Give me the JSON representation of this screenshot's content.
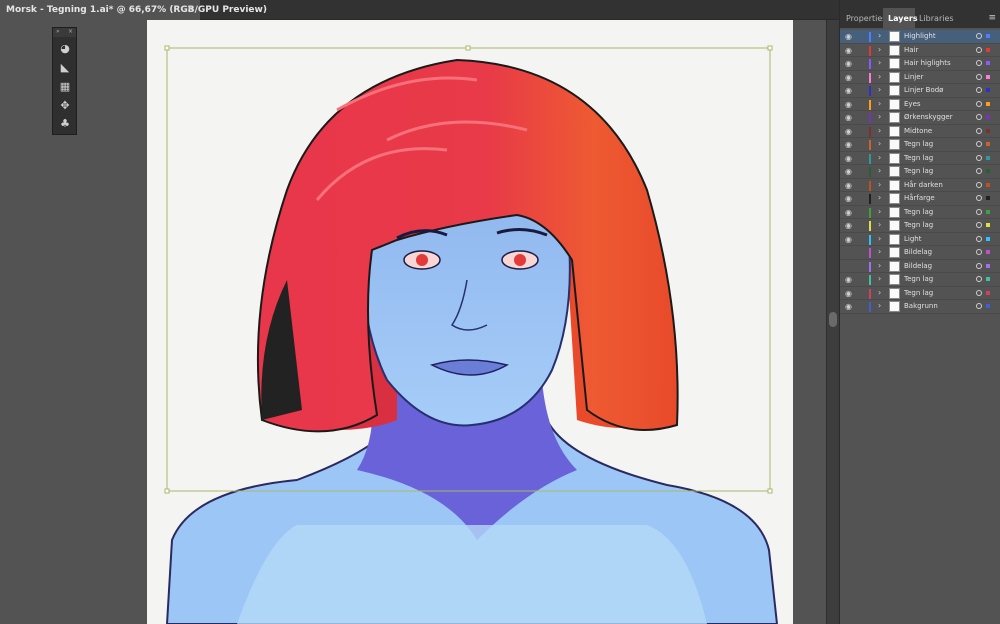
{
  "document": {
    "tab_title": "Morsk - Tegning 1.ai* @ 66,67% (RGB/GPU Preview)",
    "close_symbol": "×"
  },
  "tools": [
    {
      "icon": "palette-icon",
      "glyph": "◕"
    },
    {
      "icon": "gradient-icon",
      "glyph": "◣"
    },
    {
      "icon": "swatches-icon",
      "glyph": "▦"
    },
    {
      "icon": "puppet-warp-icon",
      "glyph": "✥"
    },
    {
      "icon": "symbols-icon",
      "glyph": "♣"
    }
  ],
  "toolpanel": {
    "collapse_symbol": "»",
    "close_symbol": "×"
  },
  "panel": {
    "tabs": [
      {
        "label": "Properties",
        "active": false
      },
      {
        "label": "Layers",
        "active": true
      },
      {
        "label": "Libraries",
        "active": false
      }
    ],
    "menu_symbol": "≡"
  },
  "layers": [
    {
      "name": "Highlight",
      "color": "#4f7fff",
      "visible": true,
      "selected": true
    },
    {
      "name": "Hair",
      "color": "#e23a3a",
      "visible": true,
      "selected": false
    },
    {
      "name": "Hair higlights",
      "color": "#8a5cff",
      "visible": true,
      "selected": false
    },
    {
      "name": "Linjer",
      "color": "#ff7ad9",
      "visible": true,
      "selected": false
    },
    {
      "name": "Linjer Bodø",
      "color": "#3030c8",
      "visible": true,
      "selected": false
    },
    {
      "name": "Eyes",
      "color": "#ff9f1a",
      "visible": true,
      "selected": false
    },
    {
      "name": "Ørkenskygger",
      "color": "#7a30c0",
      "visible": true,
      "selected": false
    },
    {
      "name": "Midtone",
      "color": "#7a3030",
      "visible": true,
      "selected": false
    },
    {
      "name": "Tegn lag",
      "color": "#d06030",
      "visible": true,
      "selected": false
    },
    {
      "name": "Tegn lag",
      "color": "#309a9a",
      "visible": true,
      "selected": false
    },
    {
      "name": "Tegn lag",
      "color": "#2a6030",
      "visible": true,
      "selected": false
    },
    {
      "name": "Hår darken",
      "color": "#c05020",
      "visible": true,
      "selected": false
    },
    {
      "name": "Hårfarge",
      "color": "#202020",
      "visible": true,
      "selected": false
    },
    {
      "name": "Tegn lag",
      "color": "#40a040",
      "visible": true,
      "selected": false
    },
    {
      "name": "Tegn lag",
      "color": "#e0e040",
      "visible": true,
      "selected": false
    },
    {
      "name": "Light",
      "color": "#30c0ff",
      "visible": true,
      "selected": false
    },
    {
      "name": "Bildelag",
      "color": "#c050d0",
      "visible": false,
      "selected": false
    },
    {
      "name": "Bildelag",
      "color": "#a070f0",
      "visible": false,
      "selected": false
    },
    {
      "name": "Tegn lag",
      "color": "#40c0a0",
      "visible": true,
      "selected": false
    },
    {
      "name": "Tegn lag",
      "color": "#d04060",
      "visible": true,
      "selected": false
    },
    {
      "name": "Bakgrunn",
      "color": "#4060d0",
      "visible": true,
      "selected": false
    }
  ]
}
